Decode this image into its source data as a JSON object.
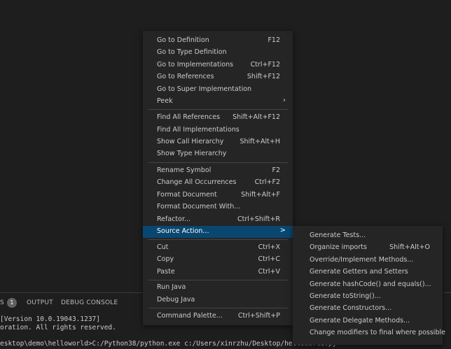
{
  "panel": {
    "badge": "1",
    "tabs": [
      "S",
      "OUTPUT",
      "DEBUG CONSOLE"
    ],
    "terminal_lines": [
      "[Version 10.0.19043.1237]",
      "oration. All rights reserved.",
      "esktop\\demo\\helloworld>C:/Python38/python.exe c:/Users/xinrzhu/Desktop/helloworld.py"
    ]
  },
  "menu": {
    "items": [
      {
        "label": "Go to Definition",
        "kb": "F12"
      },
      {
        "label": "Go to Type Definition",
        "kb": ""
      },
      {
        "label": "Go to Implementations",
        "kb": "Ctrl+F12"
      },
      {
        "label": "Go to References",
        "kb": "Shift+F12"
      },
      {
        "label": "Go to Super Implementation",
        "kb": ""
      },
      {
        "label": "Peek",
        "kb": ""
      },
      {
        "label": "Find All References",
        "kb": "Shift+Alt+F12"
      },
      {
        "label": "Find All Implementations",
        "kb": ""
      },
      {
        "label": "Show Call Hierarchy",
        "kb": "Shift+Alt+H"
      },
      {
        "label": "Show Type Hierarchy",
        "kb": ""
      },
      {
        "label": "Rename Symbol",
        "kb": "F2"
      },
      {
        "label": "Change All Occurrences",
        "kb": "Ctrl+F2"
      },
      {
        "label": "Format Document",
        "kb": "Shift+Alt+F"
      },
      {
        "label": "Format Document With...",
        "kb": ""
      },
      {
        "label": "Refactor...",
        "kb": "Ctrl+Shift+R"
      },
      {
        "label": "Source Action...",
        "kb": ""
      },
      {
        "label": "Cut",
        "kb": "Ctrl+X"
      },
      {
        "label": "Copy",
        "kb": "Ctrl+C"
      },
      {
        "label": "Paste",
        "kb": "Ctrl+V"
      },
      {
        "label": "Run Java",
        "kb": ""
      },
      {
        "label": "Debug Java",
        "kb": ""
      },
      {
        "label": "Command Palette...",
        "kb": "Ctrl+Shift+P"
      }
    ],
    "peek_arrow": "›",
    "source_action_arrow": ">"
  },
  "submenu": {
    "items": [
      {
        "label": "Generate Tests...",
        "kb": ""
      },
      {
        "label": "Organize imports",
        "kb": "Shift+Alt+O"
      },
      {
        "label": "Override/Implement Methods...",
        "kb": ""
      },
      {
        "label": "Generate Getters and Setters",
        "kb": ""
      },
      {
        "label": "Generate hashCode() and equals()...",
        "kb": ""
      },
      {
        "label": "Generate toString()...",
        "kb": ""
      },
      {
        "label": "Generate Constructors...",
        "kb": ""
      },
      {
        "label": "Generate Delegate Methods...",
        "kb": ""
      },
      {
        "label": "Change modifiers to final where possible",
        "kb": ""
      }
    ]
  },
  "colors": {
    "background": "#1e1e1e",
    "menu_bg": "#252526",
    "active_item": "#094771",
    "separator": "#454545"
  }
}
